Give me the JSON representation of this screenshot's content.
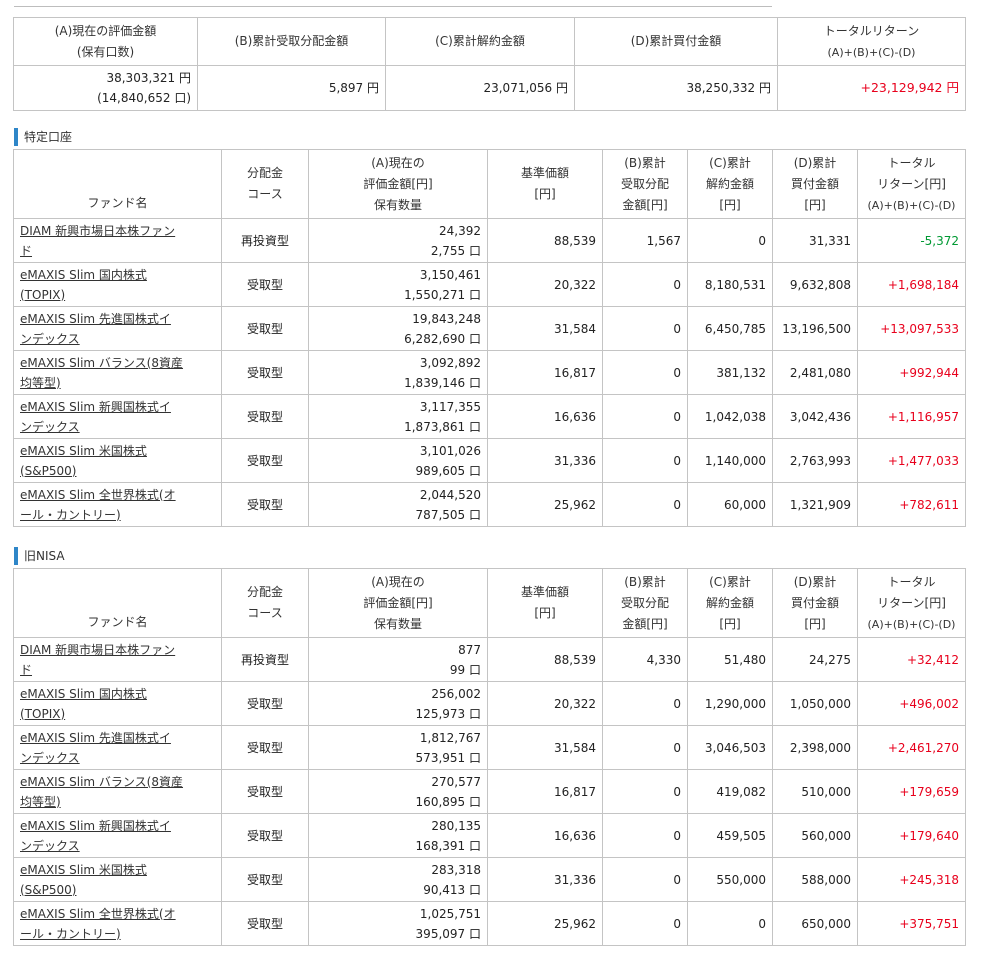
{
  "summary": {
    "headers": {
      "a_line1": "(A)現在の評価金額",
      "a_line2": "(保有口数)",
      "b": "(B)累計受取分配金額",
      "c": "(C)累計解約金額",
      "d": "(D)累計買付金額",
      "total_line1": "トータルリターン",
      "total_line2": "(A)+(B)+(C)-(D)"
    },
    "values": {
      "a_amount": "38,303,321 円",
      "a_units": "(14,840,652 口)",
      "b": "5,897 円",
      "c": "23,071,056 円",
      "d": "38,250,332 円",
      "total": "+23,129,942 円"
    }
  },
  "colors": {
    "positive": "#e8001c",
    "negative": "#009933",
    "section_bar": "#2e86c8"
  },
  "sections": [
    {
      "title": "特定口座",
      "headers": {
        "fund": "ファンド名",
        "course_l1": "分配金",
        "course_l2": "コース",
        "a_l1": "(A)現在の",
        "a_l2": "評価金額[円]",
        "a_l3": "保有数量",
        "nav_l1": "基準価額",
        "nav_l2": "[円]",
        "b_l1": "(B)累計",
        "b_l2": "受取分配",
        "b_l3": "金額[円]",
        "c_l1": "(C)累計",
        "c_l2": "解約金額",
        "c_l3": "[円]",
        "d_l1": "(D)累計",
        "d_l2": "買付金額",
        "d_l3": "[円]",
        "t_l1": "トータル",
        "t_l2": "リターン[円]",
        "t_l3": "(A)+(B)+(C)-(D)"
      },
      "rows": [
        {
          "fund_l1": "DIAM 新興市場日本株ファン",
          "fund_l2": "ド",
          "course": "再投資型",
          "amount": "24,392",
          "units": "2,755 口",
          "nav": "88,539",
          "b": "1,567",
          "c": "0",
          "d": "31,331",
          "total": "-5,372",
          "sign": "neg"
        },
        {
          "fund_l1": "eMAXIS Slim 国内株式",
          "fund_l2": "(TOPIX)",
          "course": "受取型",
          "amount": "3,150,461",
          "units": "1,550,271 口",
          "nav": "20,322",
          "b": "0",
          "c": "8,180,531",
          "d": "9,632,808",
          "total": "+1,698,184",
          "sign": "pos"
        },
        {
          "fund_l1": "eMAXIS Slim 先進国株式イ",
          "fund_l2": "ンデックス",
          "course": "受取型",
          "amount": "19,843,248",
          "units": "6,282,690 口",
          "nav": "31,584",
          "b": "0",
          "c": "6,450,785",
          "d": "13,196,500",
          "total": "+13,097,533",
          "sign": "pos"
        },
        {
          "fund_l1": "eMAXIS Slim バランス(8資産",
          "fund_l2": "均等型)",
          "course": "受取型",
          "amount": "3,092,892",
          "units": "1,839,146 口",
          "nav": "16,817",
          "b": "0",
          "c": "381,132",
          "d": "2,481,080",
          "total": "+992,944",
          "sign": "pos"
        },
        {
          "fund_l1": "eMAXIS Slim 新興国株式イ",
          "fund_l2": "ンデックス",
          "course": "受取型",
          "amount": "3,117,355",
          "units": "1,873,861 口",
          "nav": "16,636",
          "b": "0",
          "c": "1,042,038",
          "d": "3,042,436",
          "total": "+1,116,957",
          "sign": "pos"
        },
        {
          "fund_l1": "eMAXIS Slim 米国株式",
          "fund_l2": "(S&P500)",
          "course": "受取型",
          "amount": "3,101,026",
          "units": "989,605 口",
          "nav": "31,336",
          "b": "0",
          "c": "1,140,000",
          "d": "2,763,993",
          "total": "+1,477,033",
          "sign": "pos"
        },
        {
          "fund_l1": "eMAXIS Slim 全世界株式(オ",
          "fund_l2": "ール・カントリー)",
          "course": "受取型",
          "amount": "2,044,520",
          "units": "787,505 口",
          "nav": "25,962",
          "b": "0",
          "c": "60,000",
          "d": "1,321,909",
          "total": "+782,611",
          "sign": "pos"
        }
      ]
    },
    {
      "title": "旧NISA",
      "headers": {
        "fund": "ファンド名",
        "course_l1": "分配金",
        "course_l2": "コース",
        "a_l1": "(A)現在の",
        "a_l2": "評価金額[円]",
        "a_l3": "保有数量",
        "nav_l1": "基準価額",
        "nav_l2": "[円]",
        "b_l1": "(B)累計",
        "b_l2": "受取分配",
        "b_l3": "金額[円]",
        "c_l1": "(C)累計",
        "c_l2": "解約金額",
        "c_l3": "[円]",
        "d_l1": "(D)累計",
        "d_l2": "買付金額",
        "d_l3": "[円]",
        "t_l1": "トータル",
        "t_l2": "リターン[円]",
        "t_l3": "(A)+(B)+(C)-(D)"
      },
      "rows": [
        {
          "fund_l1": "DIAM 新興市場日本株ファン",
          "fund_l2": "ド",
          "course": "再投資型",
          "amount": "877",
          "units": "99 口",
          "nav": "88,539",
          "b": "4,330",
          "c": "51,480",
          "d": "24,275",
          "total": "+32,412",
          "sign": "pos"
        },
        {
          "fund_l1": "eMAXIS Slim 国内株式",
          "fund_l2": "(TOPIX)",
          "course": "受取型",
          "amount": "256,002",
          "units": "125,973 口",
          "nav": "20,322",
          "b": "0",
          "c": "1,290,000",
          "d": "1,050,000",
          "total": "+496,002",
          "sign": "pos"
        },
        {
          "fund_l1": "eMAXIS Slim 先進国株式イ",
          "fund_l2": "ンデックス",
          "course": "受取型",
          "amount": "1,812,767",
          "units": "573,951 口",
          "nav": "31,584",
          "b": "0",
          "c": "3,046,503",
          "d": "2,398,000",
          "total": "+2,461,270",
          "sign": "pos"
        },
        {
          "fund_l1": "eMAXIS Slim バランス(8資産",
          "fund_l2": "均等型)",
          "course": "受取型",
          "amount": "270,577",
          "units": "160,895 口",
          "nav": "16,817",
          "b": "0",
          "c": "419,082",
          "d": "510,000",
          "total": "+179,659",
          "sign": "pos"
        },
        {
          "fund_l1": "eMAXIS Slim 新興国株式イ",
          "fund_l2": "ンデックス",
          "course": "受取型",
          "amount": "280,135",
          "units": "168,391 口",
          "nav": "16,636",
          "b": "0",
          "c": "459,505",
          "d": "560,000",
          "total": "+179,640",
          "sign": "pos"
        },
        {
          "fund_l1": "eMAXIS Slim 米国株式",
          "fund_l2": "(S&P500)",
          "course": "受取型",
          "amount": "283,318",
          "units": "90,413 口",
          "nav": "31,336",
          "b": "0",
          "c": "550,000",
          "d": "588,000",
          "total": "+245,318",
          "sign": "pos"
        },
        {
          "fund_l1": "eMAXIS Slim 全世界株式(オ",
          "fund_l2": "ール・カントリー)",
          "course": "受取型",
          "amount": "1,025,751",
          "units": "395,097 口",
          "nav": "25,962",
          "b": "0",
          "c": "0",
          "d": "650,000",
          "total": "+375,751",
          "sign": "pos"
        }
      ]
    }
  ]
}
